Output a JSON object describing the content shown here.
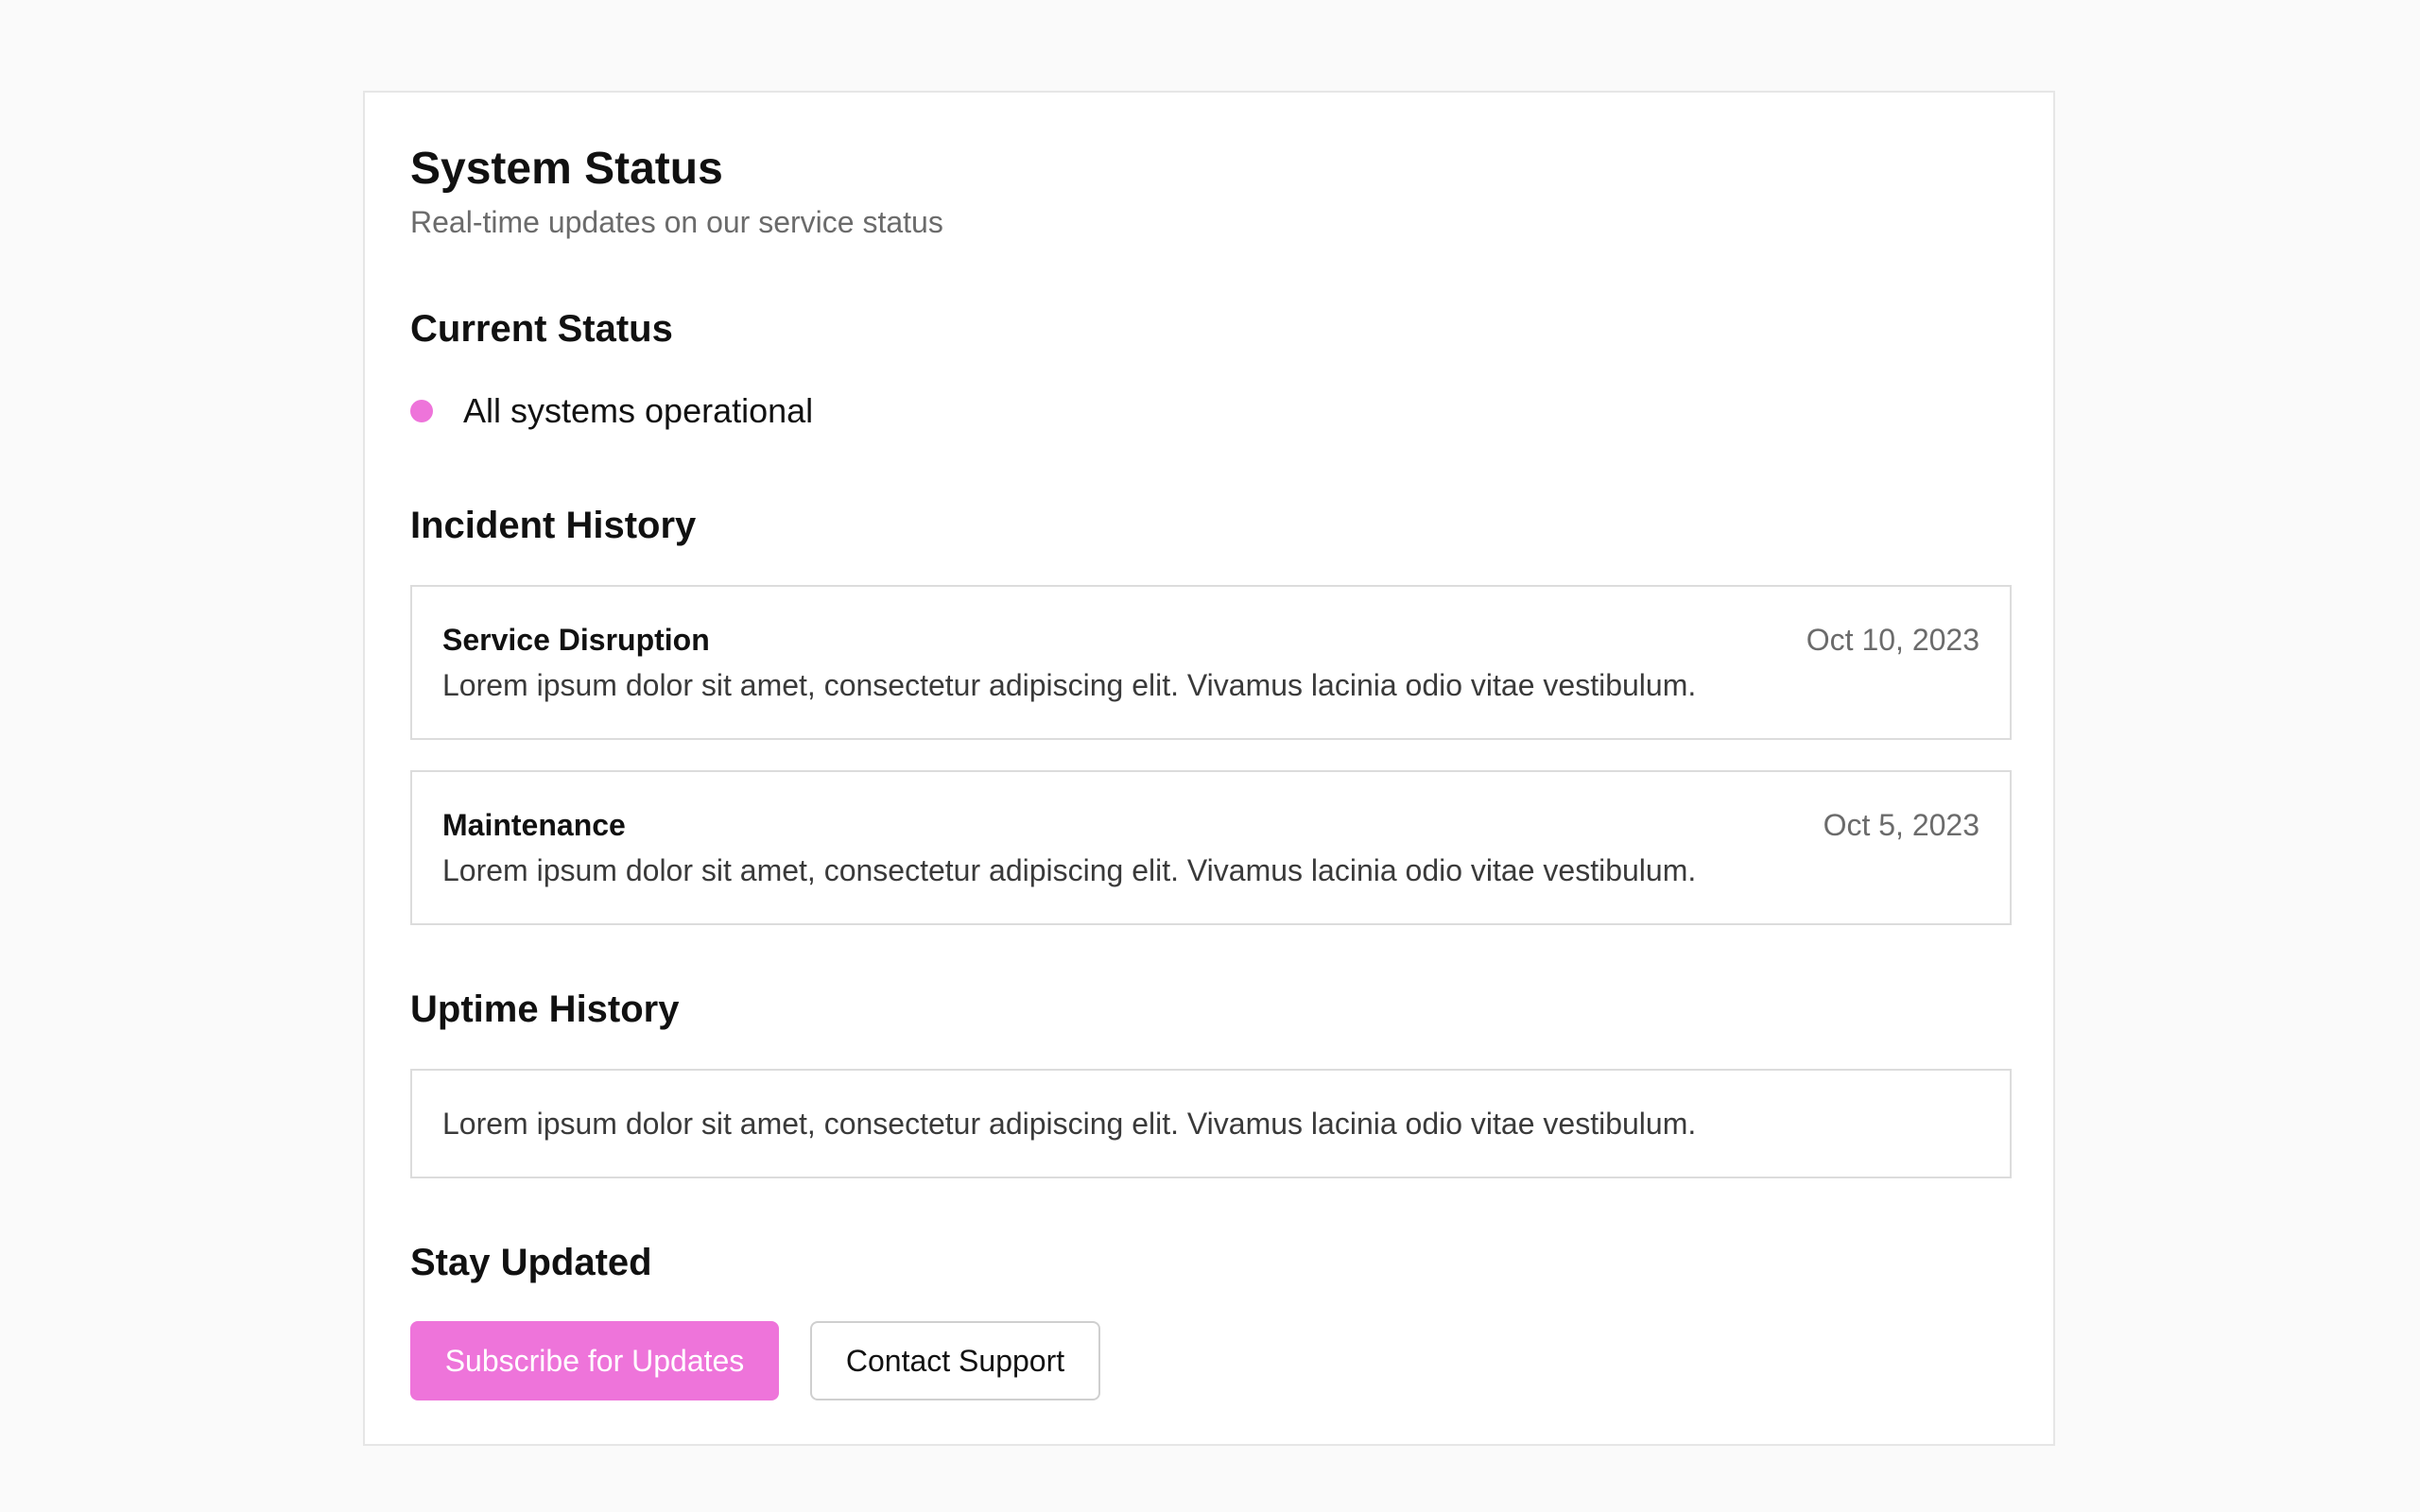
{
  "header": {
    "title": "System Status",
    "subtitle": "Real-time updates on our service status"
  },
  "current_status": {
    "heading": "Current Status",
    "indicator_color": "#ee74da",
    "text": "All systems operational"
  },
  "incident_history": {
    "heading": "Incident History",
    "incidents": [
      {
        "title": "Service Disruption",
        "date": "Oct 10, 2023",
        "description": "Lorem ipsum dolor sit amet, consectetur adipiscing elit. Vivamus lacinia odio vitae vestibulum."
      },
      {
        "title": "Maintenance",
        "date": "Oct 5, 2023",
        "description": "Lorem ipsum dolor sit amet, consectetur adipiscing elit. Vivamus lacinia odio vitae vestibulum."
      }
    ]
  },
  "uptime_history": {
    "heading": "Uptime History",
    "description": "Lorem ipsum dolor sit amet, consectetur adipiscing elit. Vivamus lacinia odio vitae vestibulum."
  },
  "stay_updated": {
    "heading": "Stay Updated",
    "subscribe_label": "Subscribe for Updates",
    "contact_label": "Contact Support"
  },
  "colors": {
    "accent": "#ee74da",
    "page_background": "#fafafa",
    "card_background": "#ffffff",
    "muted_text": "#6b6b6b"
  }
}
